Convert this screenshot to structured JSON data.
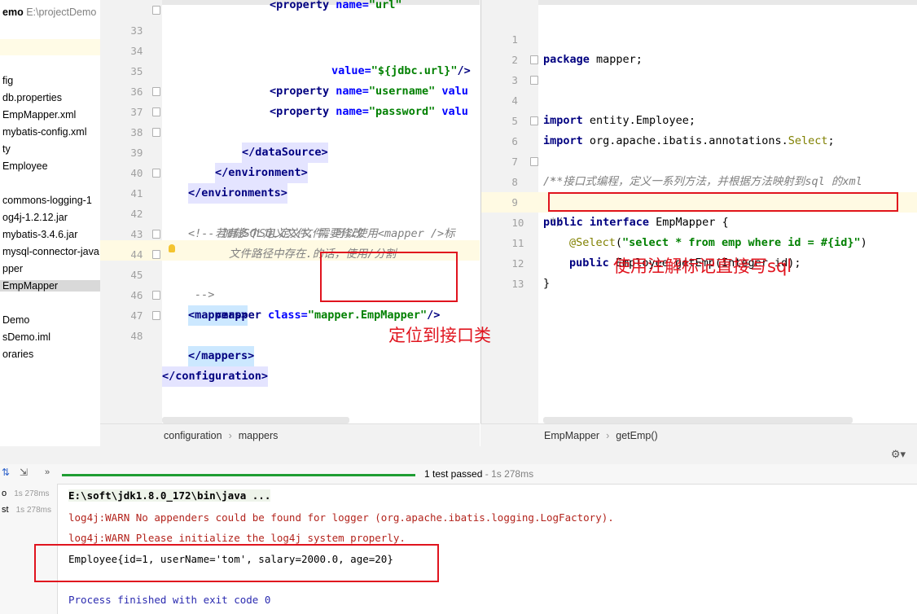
{
  "project_tree": {
    "project_name": "emo",
    "project_path": "E:\\projectDemo",
    "items": [
      "fig",
      "db.properties",
      "EmpMapper.xml",
      "mybatis-config.xml",
      "ty",
      "Employee",
      "commons-logging-1",
      "og4j-1.2.12.jar",
      "mybatis-3.4.6.jar",
      "mysql-connector-java",
      "pper",
      "EmpMapper",
      "Demo",
      "sDemo.iml",
      "oraries"
    ],
    "selected": "EmpMapper"
  },
  "left_editor": {
    "lines": [
      {
        "num": "33",
        "code": "<property name=\"url\""
      },
      {
        "num": "34",
        "code": "value=\"${jdbc.url}\"/>"
      },
      {
        "num": "35",
        "code": "<property name=\"username\" valu"
      },
      {
        "num": "36",
        "code": "<property name=\"password\" valu"
      },
      {
        "num": "37",
        "code": "</dataSource>"
      },
      {
        "num": "38",
        "code": "</environment>"
      },
      {
        "num": "39",
        "code": "</environments>"
      },
      {
        "num": "40",
        "code": ""
      },
      {
        "num": "41",
        "code": "<!-- 加载SQL定义文件，需要修改"
      },
      {
        "num": "42",
        "code": "若有多个SQL定义文件，可以使用<mapper />标"
      },
      {
        "num": "43",
        "code": "文件路径中存在.的话，使用/分割"
      },
      {
        "num": "44",
        "code": "-->"
      },
      {
        "num": "45",
        "code": "<mappers>"
      },
      {
        "num": "46",
        "code": "<mapper class=\"mapper.EmpMapper\"/>"
      },
      {
        "num": "47",
        "code": "</mappers>"
      },
      {
        "num": "48",
        "code": "</configuration>"
      }
    ],
    "breadcrumb": [
      "configuration",
      "mappers"
    ]
  },
  "right_editor": {
    "lines": [
      {
        "num": "1",
        "code": "package mapper;"
      },
      {
        "num": "2",
        "code": ""
      },
      {
        "num": "3",
        "code": "import entity.Employee;"
      },
      {
        "num": "4",
        "code": "import org.apache.ibatis.annotations.Select;"
      },
      {
        "num": "5",
        "code": ""
      },
      {
        "num": "6",
        "code": "/**"
      },
      {
        "num": "7",
        "code": " * 接口式编程，定义一系列方法，并根据方法映射到sql 的xml"
      },
      {
        "num": "8",
        "code": " */"
      },
      {
        "num": "9",
        "code": "public interface EmpMapper {"
      },
      {
        "num": "10",
        "code": "@Select(\"select * from emp where id = #{id}\")"
      },
      {
        "num": "11",
        "code": "public Employee getEmp(Integer id);"
      },
      {
        "num": "12",
        "code": "}"
      },
      {
        "num": "13",
        "code": ""
      }
    ],
    "breadcrumb": [
      "EmpMapper",
      "getEmp()"
    ]
  },
  "annotations": {
    "left_note": "定位到接口类",
    "right_note": "使用注解标记直接写sql"
  },
  "run_panel": {
    "status": "1 test passed",
    "status_time": "- 1s 278ms",
    "tests": [
      {
        "label": "o",
        "time": "1s 278ms"
      },
      {
        "label": "st",
        "time": "1s 278ms"
      }
    ],
    "console": [
      "E:\\soft\\jdk1.8.0_172\\bin\\java ...",
      "log4j:WARN No appenders could be found for logger (org.apache.ibatis.logging.LogFactory).",
      "log4j:WARN Please initialize the log4j system properly.",
      "Employee{id=1, userName='tom', salary=2000.0, age=20}",
      "",
      "Process finished with exit code 0"
    ]
  },
  "colors": {
    "annotation_red": "#e0141e",
    "progress_green": "#1f9d33"
  }
}
